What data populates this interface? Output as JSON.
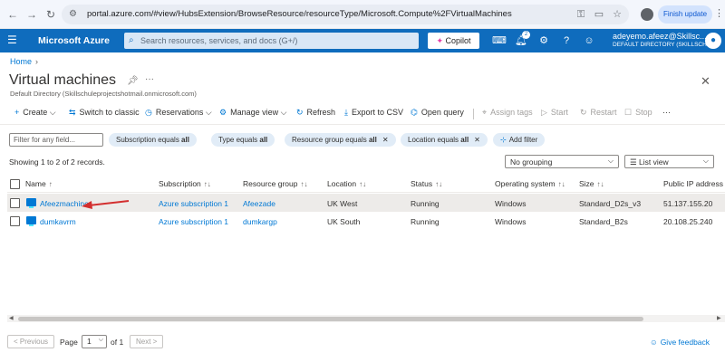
{
  "browser": {
    "url": "portal.azure.com/#view/HubsExtension/BrowseResource/resourceType/Microsoft.Compute%2FVirtualMachines",
    "finish_update": "Finish update"
  },
  "azure": {
    "brand": "Microsoft Azure",
    "search_placeholder": "Search resources, services, and docs (G+/)",
    "copilot": "Copilot",
    "notification_count": "2",
    "user_name": "adeyemo.afeez@Skillsc...",
    "user_directory": "DEFAULT DIRECTORY (SKILLSCHU..."
  },
  "breadcrumb": {
    "home": "Home"
  },
  "page": {
    "title": "Virtual machines",
    "subtitle": "Default Directory (Skillschuleprojectshotmail.onmicrosoft.com)"
  },
  "commands": {
    "create": "Create",
    "switch_classic": "Switch to classic",
    "reservations": "Reservations",
    "manage_view": "Manage view",
    "refresh": "Refresh",
    "export_csv": "Export to CSV",
    "open_query": "Open query",
    "assign_tags": "Assign tags",
    "start": "Start",
    "restart": "Restart",
    "stop": "Stop"
  },
  "filters": {
    "placeholder": "Filter for any field...",
    "subscription": {
      "label": "Subscription equals ",
      "value": "all"
    },
    "type": {
      "label": "Type equals ",
      "value": "all"
    },
    "resource_group": {
      "label": "Resource group equals ",
      "value": "all"
    },
    "location": {
      "label": "Location equals ",
      "value": "all"
    },
    "add_filter": "Add filter"
  },
  "records": "Showing 1 to 2 of 2 records.",
  "grouping": "No grouping",
  "list_view": "List view",
  "table": {
    "headers": {
      "name": "Name",
      "subscription": "Subscription",
      "resource_group": "Resource group",
      "location": "Location",
      "status": "Status",
      "os": "Operating system",
      "size": "Size",
      "public_ip": "Public IP address"
    },
    "rows": [
      {
        "name": "Afeezmachine",
        "subscription": "Azure subscription 1",
        "resource_group": "Afeezade",
        "location": "UK West",
        "status": "Running",
        "os": "Windows",
        "size": "Standard_D2s_v3",
        "public_ip": "51.137.155.20"
      },
      {
        "name": "dumkavrm",
        "subscription": "Azure subscription 1",
        "resource_group": "dumkargp",
        "location": "UK South",
        "status": "Running",
        "os": "Windows",
        "size": "Standard_B2s",
        "public_ip": "20.108.25.240"
      }
    ]
  },
  "pagination": {
    "previous": "< Previous",
    "page_label": "Page",
    "page_value": "1",
    "of_label": "of 1",
    "next": "Next >"
  },
  "feedback": "Give feedback",
  "colors": {
    "azure_blue": "#0f6cbd",
    "link": "#0078d4",
    "annotation_arrow": "#d32f2f"
  }
}
